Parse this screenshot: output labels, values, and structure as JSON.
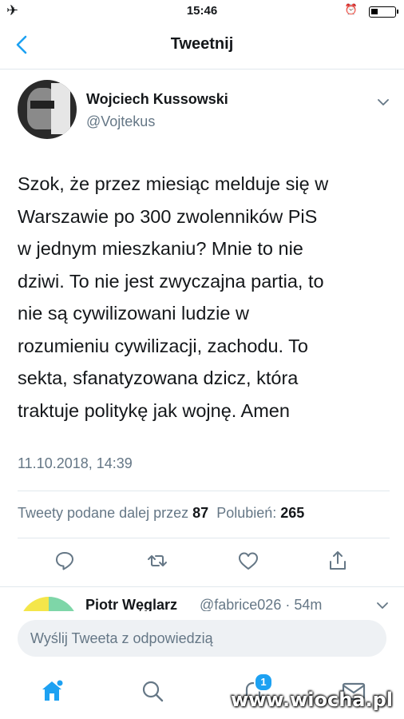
{
  "status_bar": {
    "time": "15:46",
    "icons": [
      "airplane-icon",
      "alarm-icon",
      "battery-icon"
    ]
  },
  "header": {
    "title": "Tweetnij"
  },
  "tweet": {
    "author_name": "Wojciech Kussowski",
    "author_handle": "@Vojtekus",
    "lines": [
      "Szok, że przez miesiąc melduje się w",
      "Warszawie po 300 zwolenników PiS",
      "w jednym mieszkaniu? Mnie to nie",
      "dziwi. To nie jest zwyczajna partia, to",
      "nie są cywilizowani ludzie w",
      "rozumieniu cywilizacji, zachodu. To",
      "sekta, sfanatyzowana dzicz, która",
      "traktuje politykę jak wojnę. Amen"
    ],
    "timestamp": "11.10.2018, 14:39",
    "retweets_label": "Tweety podane dalej przez",
    "retweets_count": "87",
    "likes_label": "Polubień:",
    "likes_count": "265"
  },
  "reply_preview": {
    "name": "Piotr Węglarz",
    "meta": "@fabrice026 · 54m"
  },
  "composer": {
    "placeholder": "Wyślij Tweeta z odpowiedzią"
  },
  "tabbar": {
    "notifications_badge": "1"
  },
  "watermark": "www.wiocha.pl",
  "colors": {
    "accent": "#1da1f2",
    "secondary_text": "#657786",
    "divider": "#e1e8ed"
  }
}
